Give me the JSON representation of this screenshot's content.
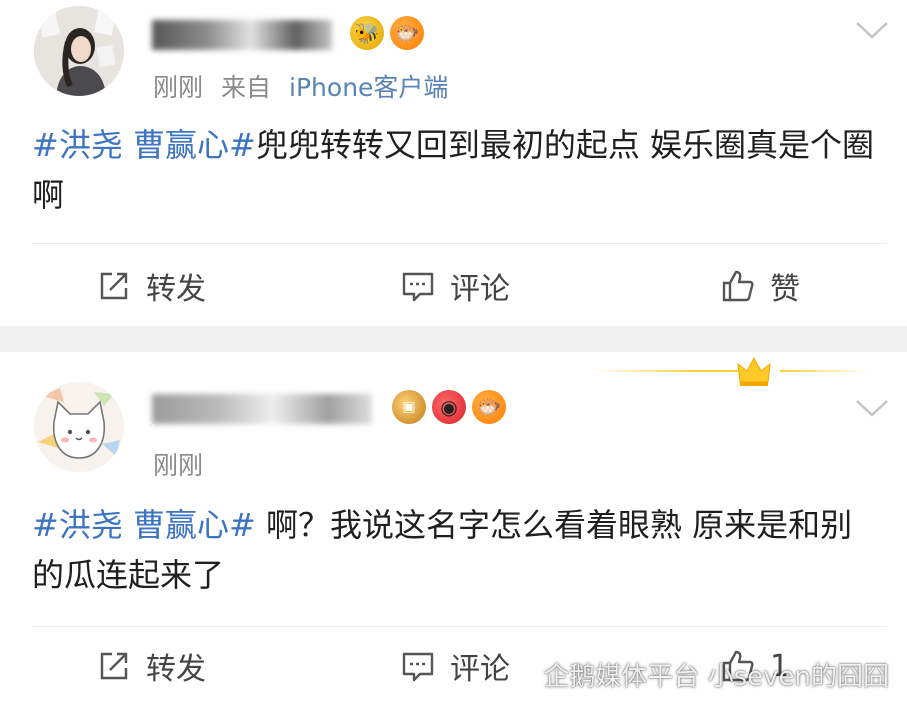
{
  "post1": {
    "username": "",
    "time": "刚刚",
    "from_label": "来自",
    "source": "iPhone客户端",
    "content_hashtag": "#洪尧 曹赢心#",
    "content_text": "兜兜转转又回到最初的起点 娱乐圈真是个圈啊",
    "actions": {
      "repost": "转发",
      "comment": "评论",
      "like": "赞"
    },
    "badges": [
      "bee-badge-icon",
      "fish-badge-icon"
    ]
  },
  "post2": {
    "username": "",
    "time": "刚刚",
    "content_hashtag": "#洪尧 曹赢心#",
    "content_text": " 啊？我说这名字怎么看着眼熟 原来是和别的瓜连起来了",
    "actions": {
      "repost": "转发",
      "comment": "评论",
      "like_count": "1"
    },
    "badges": [
      "vip-badge-icon",
      "camera-badge-icon",
      "fish-badge-icon"
    ]
  },
  "watermark": {
    "text": "企鹅媒体平台 小seven的囧囧"
  },
  "colors": {
    "hashtag": "#3c74c2",
    "source": "#5a84b4",
    "meta": "#8a8a8a",
    "separator": "#f1f1f1",
    "crown": "#ffcf3a"
  }
}
